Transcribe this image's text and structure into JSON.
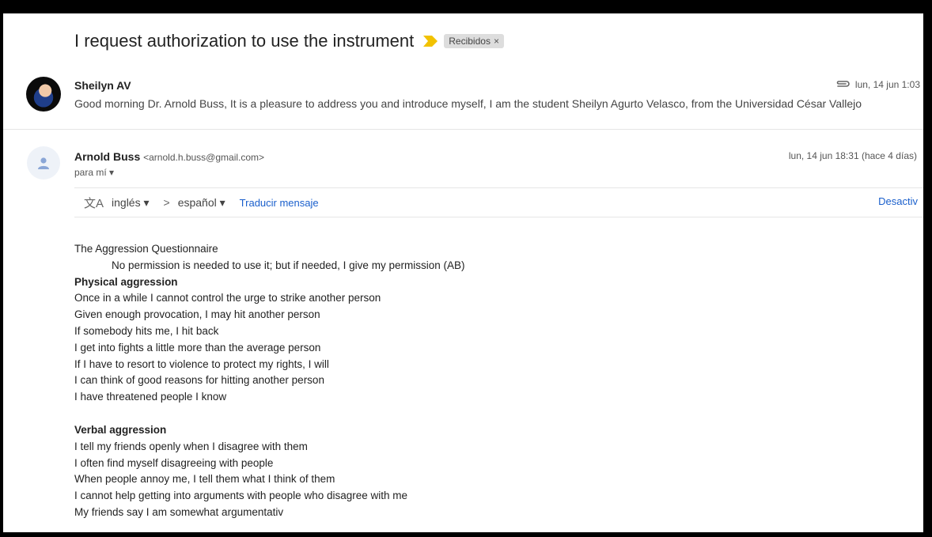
{
  "thread": {
    "subject": "I request authorization to use the instrument",
    "label": "Recibidos",
    "label_close": "×"
  },
  "message1": {
    "sender": "Sheilyn AV",
    "date": "lun, 14 jun 1:03",
    "snippet": "Good morning Dr. Arnold Buss, It is a pleasure to address you and introduce myself, I am the student Sheilyn Agurto Velasco, from the Universidad César Vallejo"
  },
  "message2": {
    "sender": "Arnold Buss",
    "email": "<arnold.h.buss@gmail.com>",
    "to": "para mí ▾",
    "date": "lun, 14 jun 18:31 (hace 4 días)",
    "translate": {
      "icon": "文A",
      "from": "inglés ▾",
      "arrow": ">",
      "to": "español ▾",
      "action": "Traducir mensaje",
      "disable": "Desactiv"
    },
    "body": {
      "title": "The Aggression Questionnaire",
      "permission": "No permission is needed to use it; but if needed, I give my permission (AB)",
      "section1_heading": "Physical aggression",
      "section1_items": [
        "Once in a while I cannot control the urge to strike another person",
        "Given enough provocation, I may hit another person",
        "If somebody hits me, I hit back",
        "I get into fights a little more than the average person",
        "If I have to resort to violence to protect my rights, I will",
        "I can think of good reasons for hitting another person",
        "I have threatened people I know"
      ],
      "section2_heading": "Verbal aggression",
      "section2_items": [
        "I tell my friends openly when I disagree with them",
        "I often find myself disagreeing with people",
        "When people annoy me, I tell them what I think of them",
        "I cannot help getting into arguments with people who disagree with me",
        "My friends say I am somewhat argumentativ"
      ]
    }
  },
  "colors": {
    "link": "#1a5fcc",
    "important_marker": "#f2c200",
    "label_chip": "#dddddd"
  },
  "icons": {
    "important": "important-marker-icon",
    "attachment": "paperclip-icon",
    "avatar_default": "person-icon",
    "translate": "translate-icon"
  }
}
